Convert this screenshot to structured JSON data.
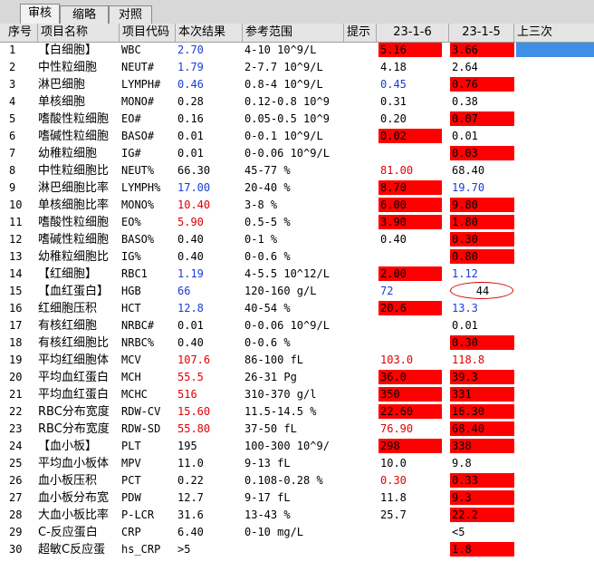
{
  "tabs": [
    "审核",
    "缩略",
    "对照"
  ],
  "headers": [
    "序号",
    "项目名称",
    "项目代码",
    "本次结果",
    "参考范围",
    "提示",
    "23-1-6",
    "23-1-5",
    "上三次"
  ],
  "rows": [
    {
      "no": "1",
      "name": "【白细胞】",
      "code": "WBC",
      "result": "2.70",
      "rc": "blue",
      "range": "4-10 10^9/L",
      "h1": "5.16",
      "h1red": true,
      "h2": "3.66",
      "h2red": true
    },
    {
      "no": "2",
      "name": "中性粒细胞",
      "code": "NEUT#",
      "result": "1.79",
      "rc": "blue",
      "range": "2-7.7 10^9/L",
      "h1": "4.18",
      "h1red": false,
      "h2": "2.64",
      "h2red": false
    },
    {
      "no": "3",
      "name": "淋巴细胞",
      "code": "LYMPH#",
      "result": "0.46",
      "rc": "blue",
      "range": "0.8-4 10^9/L",
      "h1": "0.45",
      "h1red": false,
      "h1c": "blue",
      "h2": "0.76",
      "h2red": true
    },
    {
      "no": "4",
      "name": "单核细胞",
      "code": "MONO#",
      "result": "0.28",
      "rc": "",
      "range": "0.12-0.8 10^9",
      "h1": "0.31",
      "h1red": false,
      "h2": "0.38",
      "h2red": false
    },
    {
      "no": "5",
      "name": "嗜酸性粒细胞",
      "code": "EO#",
      "result": "0.16",
      "rc": "",
      "range": "0.05-0.5 10^9",
      "h1": "0.20",
      "h1red": false,
      "h2": "0.07",
      "h2red": true
    },
    {
      "no": "6",
      "name": "嗜碱性粒细胞",
      "code": "BASO#",
      "result": "0.01",
      "rc": "",
      "range": "0-0.1 10^9/L",
      "h1": "0.02",
      "h1red": true,
      "h2": "0.01",
      "h2red": false
    },
    {
      "no": "7",
      "name": "幼稚粒细胞",
      "code": "IG#",
      "result": "0.01",
      "rc": "",
      "range": "0-0.06 10^9/L",
      "h1": "",
      "h1red": false,
      "h2": "0.03",
      "h2red": true
    },
    {
      "no": "8",
      "name": "中性粒细胞比",
      "code": "NEUT%",
      "result": "66.30",
      "rc": "",
      "range": "45-77 %",
      "h1": "81.00",
      "h1red": false,
      "h1c": "red",
      "h2": "68.40",
      "h2red": false
    },
    {
      "no": "9",
      "name": "淋巴细胞比率",
      "code": "LYMPH%",
      "result": "17.00",
      "rc": "blue",
      "range": "20-40 %",
      "h1": "8.70",
      "h1red": true,
      "h2": "19.70",
      "h2red": false,
      "h2c": "blue"
    },
    {
      "no": "10",
      "name": "单核细胞比率",
      "code": "MONO%",
      "result": "10.40",
      "rc": "red",
      "range": "3-8 %",
      "h1": "6.00",
      "h1red": true,
      "h2": "9.80",
      "h2red": true
    },
    {
      "no": "11",
      "name": "嗜酸性粒细胞",
      "code": "EO%",
      "result": "5.90",
      "rc": "red",
      "range": "0.5-5 %",
      "h1": "3.90",
      "h1red": true,
      "h2": "1.80",
      "h2red": true
    },
    {
      "no": "12",
      "name": "嗜碱性粒细胞",
      "code": "BASO%",
      "result": "0.40",
      "rc": "",
      "range": "0-1 %",
      "h1": "0.40",
      "h1red": false,
      "h2": "0.30",
      "h2red": true
    },
    {
      "no": "13",
      "name": "幼稚粒细胞比",
      "code": "IG%",
      "result": "0.40",
      "rc": "",
      "range": "0-0.6 %",
      "h1": "",
      "h1red": false,
      "h2": "0.80",
      "h2red": true
    },
    {
      "no": "14",
      "name": "【红细胞】",
      "code": "RBC1",
      "result": "1.19",
      "rc": "blue",
      "range": "4-5.5 10^12/L",
      "h1": "2.00",
      "h1red": true,
      "h2": "1.12",
      "h2red": false,
      "h2c": "blue"
    },
    {
      "no": "15",
      "name": "【血红蛋白】",
      "code": "HGB",
      "result": "66",
      "rc": "blue",
      "range": "120-160 g/L",
      "h1": "72",
      "h1red": false,
      "h1c": "blue",
      "h2": "44",
      "h2red": false,
      "h2center": true
    },
    {
      "no": "16",
      "name": "红细胞压积",
      "code": "HCT",
      "result": "12.8",
      "rc": "blue",
      "range": "40-54 %",
      "h1": "20.6",
      "h1red": true,
      "h2": "13.3",
      "h2red": false,
      "h2c": "blue"
    },
    {
      "no": "17",
      "name": "有核红细胞",
      "code": "NRBC#",
      "result": "0.01",
      "rc": "",
      "range": "0-0.06 10^9/L",
      "h1": "",
      "h1red": false,
      "h2": "0.01",
      "h2red": false
    },
    {
      "no": "18",
      "name": "有核红细胞比",
      "code": "NRBC%",
      "result": "0.40",
      "rc": "",
      "range": "0-0.6 %",
      "h1": "",
      "h1red": false,
      "h2": "0.30",
      "h2red": true
    },
    {
      "no": "19",
      "name": "平均红细胞体",
      "code": "MCV",
      "result": "107.6",
      "rc": "red",
      "range": "86-100 fL",
      "h1": "103.0",
      "h1red": false,
      "h1c": "red",
      "h2": "118.8",
      "h2red": false,
      "h2c": "red"
    },
    {
      "no": "20",
      "name": "平均血红蛋白",
      "code": "MCH",
      "result": "55.5",
      "rc": "red",
      "range": "26-31 Pg",
      "h1": "36.0",
      "h1red": true,
      "h2": "39.3",
      "h2red": true
    },
    {
      "no": "21",
      "name": "平均血红蛋白",
      "code": "MCHC",
      "result": "516",
      "rc": "red",
      "range": "310-370 g/l",
      "h1": "350",
      "h1red": true,
      "h2": "331",
      "h2red": true
    },
    {
      "no": "22",
      "name": "RBC分布宽度",
      "code": "RDW-CV",
      "result": "15.60",
      "rc": "red",
      "range": "11.5-14.5 %",
      "h1": "22.60",
      "h1red": true,
      "h2": "16.30",
      "h2red": true
    },
    {
      "no": "23",
      "name": "RBC分布宽度",
      "code": "RDW-SD",
      "result": "55.80",
      "rc": "red",
      "range": "37-50 fL",
      "h1": "76.90",
      "h1red": false,
      "h1c": "red",
      "h2": "68.40",
      "h2red": true
    },
    {
      "no": "24",
      "name": "【血小板】",
      "code": "PLT",
      "result": "195",
      "rc": "",
      "range": "100-300 10^9/",
      "h1": "298",
      "h1red": true,
      "h2": "338",
      "h2red": true
    },
    {
      "no": "25",
      "name": "平均血小板体",
      "code": "MPV",
      "result": "11.0",
      "rc": "",
      "range": "9-13 fL",
      "h1": "10.0",
      "h1red": false,
      "h2": "9.8",
      "h2red": false
    },
    {
      "no": "26",
      "name": "血小板压积",
      "code": "PCT",
      "result": "0.22",
      "rc": "",
      "range": "0.108-0.28 %",
      "h1": "0.30",
      "h1red": false,
      "h1c": "red",
      "h2": "0.33",
      "h2red": true
    },
    {
      "no": "27",
      "name": "血小板分布宽",
      "code": "PDW",
      "result": "12.7",
      "rc": "",
      "range": "9-17 fL",
      "h1": "11.8",
      "h1red": false,
      "h2": "9.3",
      "h2red": true
    },
    {
      "no": "28",
      "name": "大血小板比率",
      "code": "P-LCR",
      "result": "31.6",
      "rc": "",
      "range": "13-43 %",
      "h1": "25.7",
      "h1red": false,
      "h2": "22.2",
      "h2red": true
    },
    {
      "no": "29",
      "name": "C-反应蛋白",
      "code": "CRP",
      "result": "6.40",
      "rc": "",
      "range": "0-10 mg/L",
      "h1": "",
      "h1red": false,
      "h2": "<5",
      "h2red": false
    },
    {
      "no": "30",
      "name": "超敏C反应蛋",
      "code": "hs_CRP",
      "result": ">5",
      "rc": "",
      "range": "",
      "h1": "",
      "h1red": false,
      "h2": "1.8",
      "h2red": true
    }
  ],
  "colors": {
    "red_cell": "#ff0000",
    "selected": "#3f8fe6",
    "blue_text": "#1a3cd6",
    "red_text": "#e00000"
  }
}
